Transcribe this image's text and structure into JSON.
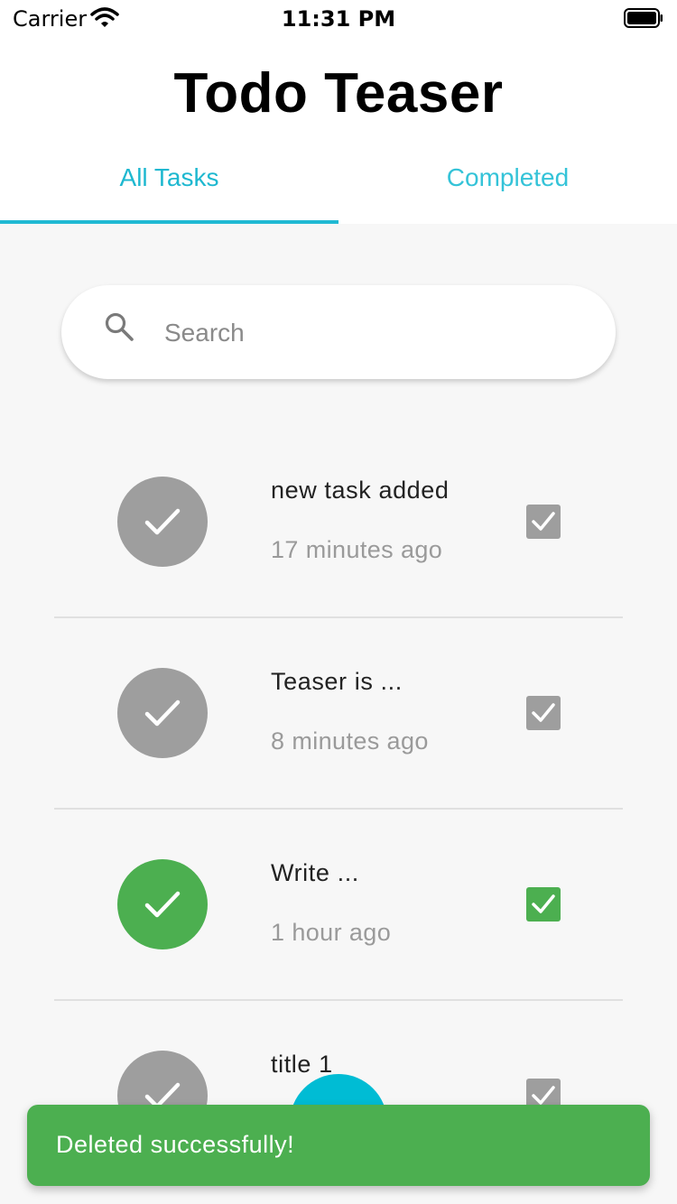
{
  "status_bar": {
    "carrier": "Carrier",
    "time": "11:31 PM",
    "wifi_icon": "wifi-icon",
    "battery_icon": "battery-full-icon"
  },
  "header": {
    "title": "Todo Teaser",
    "tabs": [
      {
        "label": "All Tasks",
        "selected": true
      },
      {
        "label": "Completed",
        "selected": false
      }
    ]
  },
  "search": {
    "placeholder": "Search",
    "value": "",
    "icon": "search-icon"
  },
  "tasks": [
    {
      "title": "new task added",
      "time": "17 minutes ago",
      "completed": false,
      "checked": true
    },
    {
      "title": "Teaser is ...",
      "time": "8 minutes ago",
      "completed": false,
      "checked": true
    },
    {
      "title": "Write ...",
      "time": "1 hour ago",
      "completed": true,
      "checked": true
    },
    {
      "title": "title 1",
      "time": "",
      "completed": false,
      "checked": true
    }
  ],
  "fab": {
    "icon": "add-icon"
  },
  "snackbar": {
    "message": "Deleted successfully!"
  },
  "colors": {
    "accent": "#1eb8d0",
    "fab": "#00bcd4",
    "success": "#4caf50",
    "inactive": "#9e9e9e",
    "divider": "#e0e0e0"
  }
}
